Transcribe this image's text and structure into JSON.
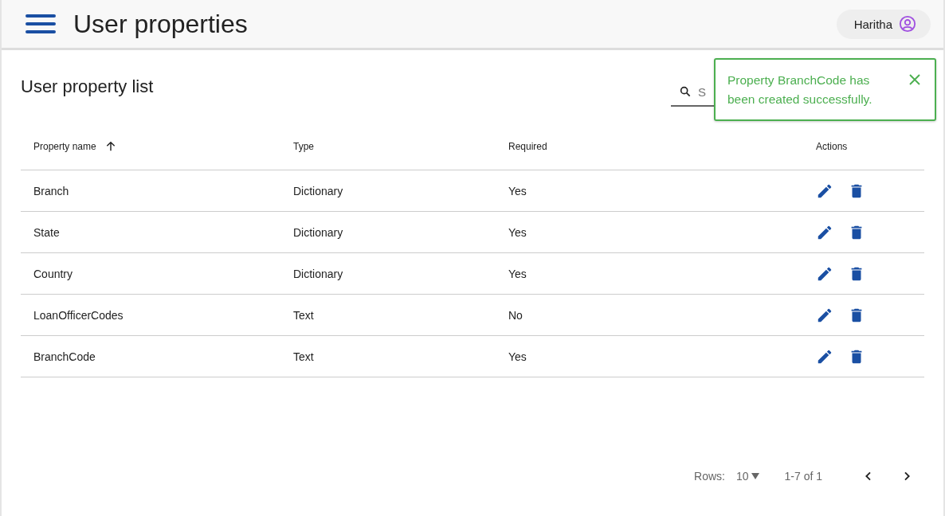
{
  "header": {
    "title": "User properties",
    "user": "Haritha"
  },
  "page_title": "User property list",
  "search": {
    "placeholder": "S"
  },
  "toast": {
    "message": "Property BranchCode has been created successfully."
  },
  "table": {
    "columns": [
      {
        "label": "Property name",
        "sorted": true
      },
      {
        "label": "Type",
        "sorted": false
      },
      {
        "label": "Required",
        "sorted": false
      },
      {
        "label": "Actions",
        "sorted": false
      }
    ],
    "rows": [
      {
        "name": "Branch",
        "type": "Dictionary",
        "required": "Yes"
      },
      {
        "name": "State",
        "type": "Dictionary",
        "required": "Yes"
      },
      {
        "name": "Country",
        "type": "Dictionary",
        "required": "Yes"
      },
      {
        "name": "LoanOfficerCodes",
        "type": "Text",
        "required": "No"
      },
      {
        "name": "BranchCode",
        "type": "Text",
        "required": "Yes"
      }
    ]
  },
  "pagination": {
    "rows_label": "Rows:",
    "rows_per_page": "10",
    "range": "1-7 of 1"
  }
}
